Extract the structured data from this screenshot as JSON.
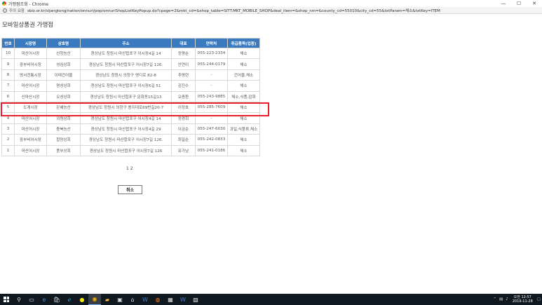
{
  "window": {
    "title": "가맹점조회 - Chrome",
    "controls": {
      "minimize": "—",
      "maximize": "☐",
      "close": "✕"
    }
  },
  "address_bar": {
    "security_label": "주의 요함",
    "url": "sbiz.or.kr/sijangtong/nation/onnuri/pop/onnuriShopListKeyPopup.do?cpage=2&mkt_cd=&shop_table=SITT.MKT_MOBILE_SHOP&deal_item=&shop_nm=&county_cd=55010&city_cd=55&txtParam=채소&txtKey=ITEM"
  },
  "page": {
    "title": "모바일상품권 가맹점"
  },
  "table": {
    "headers": [
      "번호",
      "시장명",
      "상호명",
      "주소",
      "대표",
      "연락처",
      "취급품목(업종)"
    ],
    "rows": [
      [
        "10",
        "마산어시장",
        "신창농산",
        "경상남도 창원시 마산합포구 어시장4길 14",
        "정평순",
        "055-223-2334",
        "채소"
      ],
      [
        "9",
        "중부비어시장",
        "성심상회",
        "경상남도 창원시 마산합포구 어시장7길 126.",
        "안연이",
        "055-244-0179",
        "채소"
      ],
      [
        "8",
        "명서전통시장",
        "이태건어물",
        "경상남도 창원시 의창구 명디로 82-8",
        "추명련",
        "-",
        "건어물,채소"
      ],
      [
        "7",
        "마산어시장",
        "명성상회",
        "경상남도 창원시 마산합포구 어시장6길 51",
        "김진수",
        "-",
        "채소"
      ],
      [
        "6",
        "신마산시장",
        "오성상회",
        "경상남도 창원시 마산합포구 문화동15길13",
        "오종환",
        "055-243-9885",
        "채소,식품,잡화"
      ],
      [
        "5",
        "도계시장",
        "은혜농산",
        "경상남도 창원시 의창구 용지대로69번길20-7",
        "이정호",
        "055-285-7609",
        "채소"
      ],
      [
        "4",
        "마산어시장",
        "의령상회",
        "경상남도 창원시 마산합포구 어시장4길 14",
        "정경희",
        "-",
        "채소"
      ],
      [
        "3",
        "마산어시장",
        "충북농산",
        "경상남도 창원시 마산합포구 어시장4길 29",
        "이금순",
        "055-247-6030",
        "과일,식품류,채소"
      ],
      [
        "2",
        "중부비어시장",
        "합양상회",
        "경상남도 창원시 마산합포구 어시장7길 126.",
        "최일순",
        "055-242-0833",
        "채소"
      ],
      [
        "1",
        "마산어시장",
        "풍부상회",
        "경상남도 창원시 마산합포구 어시장7길 126",
        "유가남",
        "055-241-0186",
        "채소"
      ]
    ]
  },
  "pagination": {
    "pages": "1 2"
  },
  "cancel_label": "취소",
  "taskbar": {
    "icons": [
      "windows-logo",
      "search-icon",
      "task-view-icon",
      "edge-icon",
      "store-icon",
      "ie-icon",
      "kakaotalk-icon",
      "chrome-icon",
      "folder-icon",
      "photos-icon",
      "app-icon",
      "word-icon",
      "firefox-icon",
      "app-icon-2",
      "word-icon-2",
      "picture-icon"
    ],
    "clock_time": "오전 12:57",
    "clock_date": "2019-11-28"
  }
}
